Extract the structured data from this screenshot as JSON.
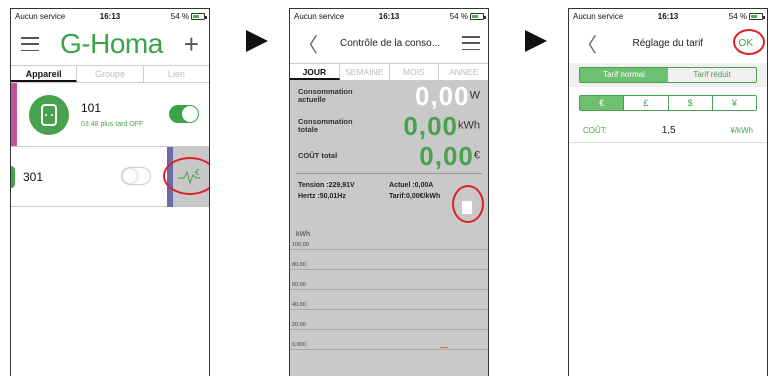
{
  "status": {
    "carrier": "Aucun service",
    "time": "16:13",
    "battery": "54 %"
  },
  "screen1": {
    "logo": "G-Homa",
    "tabs": [
      "Appareil",
      "Groupe",
      "Lien"
    ],
    "devices": [
      {
        "name": "101",
        "sub": "03:48 plus tard OFF",
        "on": true
      },
      {
        "name": "301",
        "on": false
      }
    ]
  },
  "screen2": {
    "title": "Contrôle de la conso...",
    "tabs": [
      "JOUR",
      "SEMAINE",
      "MOIS",
      "ANNEE"
    ],
    "rows": [
      {
        "label": "Consommation actuelle",
        "value": "0,00",
        "unit": "W"
      },
      {
        "label": "Consommation totale",
        "value": "0,00",
        "unit": "kWh"
      },
      {
        "label": "COÛT total",
        "value": "0,00",
        "unit": "€"
      }
    ],
    "info": {
      "tension": "Tension :229,91V",
      "actuel": "Actuel :0,00A",
      "hertz": "Hertz :50,01Hz",
      "tarif": "Tarif:0,00€/kWh"
    },
    "chart": {
      "ylabel": "kWh",
      "ticks": [
        "100,00",
        "80,00",
        "60,00",
        "40,00",
        "20,00",
        "0,000"
      ]
    }
  },
  "screen3": {
    "title": "Réglage du tarif",
    "ok": "OK",
    "tariff_tabs": [
      "Tarif normal",
      "Tarif réduit"
    ],
    "currencies": [
      "€",
      "£",
      "$",
      "¥"
    ],
    "cost_label": "COÛT:",
    "cost_value": "1,5",
    "cost_unit": "¥/kWh"
  },
  "colors": {
    "accent": "#3aa34a",
    "highlight": "#dd2222"
  }
}
